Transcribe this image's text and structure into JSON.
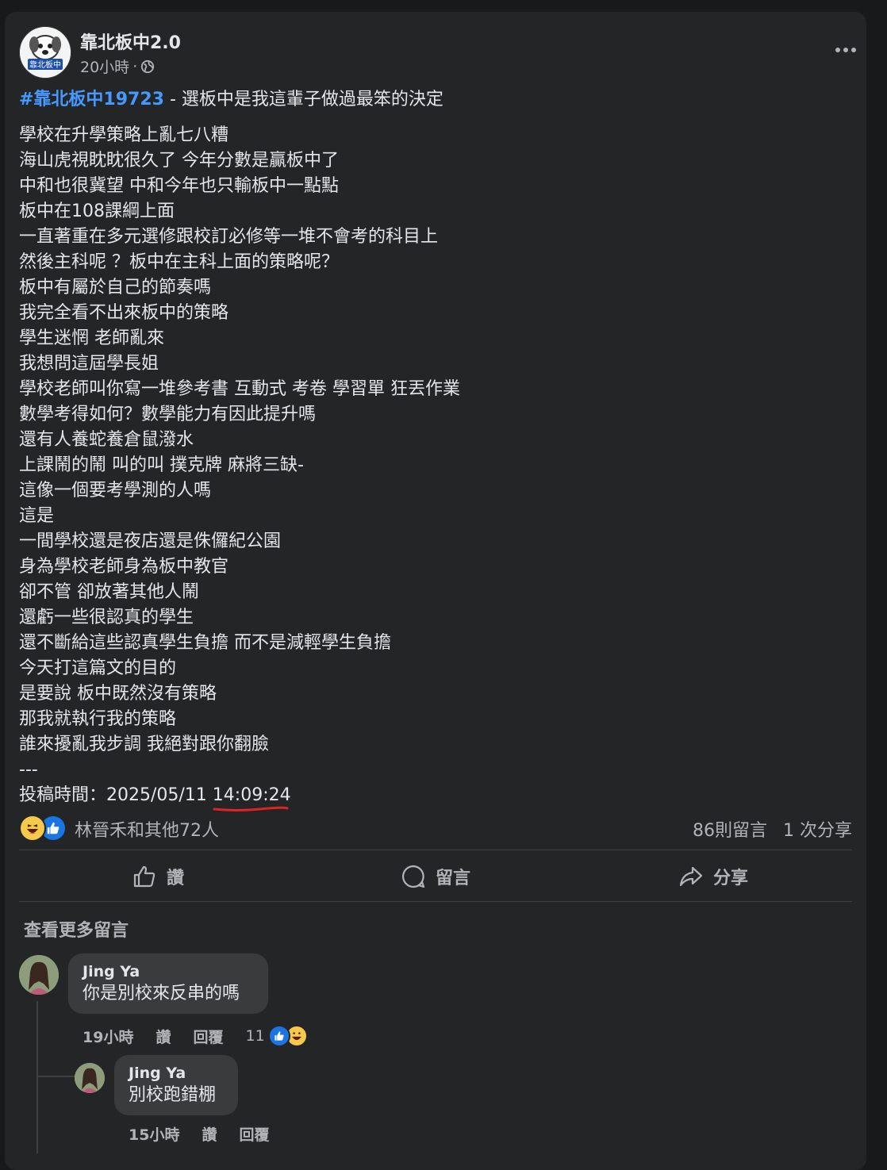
{
  "post": {
    "page_name": "靠北板中2.0",
    "time": "20小時",
    "separator": "·",
    "hashtag": "#靠北板中19723",
    "title_rest": " - 選板中是我這輩子做過最笨的決定",
    "body_lines": [
      "學校在升學策略上亂七八糟",
      "海山虎視眈眈很久了 今年分數是贏板中了",
      "中和也很冀望 中和今年也只輸板中一點點",
      "板中在108課綱上面",
      "一直著重在多元選修跟校訂必修等一堆不會考的科目上",
      "然後主科呢 ？板中在主科上面的策略呢？",
      "板中有屬於自己的節奏嗎",
      "我完全看不出來板中的策略",
      "學生迷惘 老師亂來",
      "我想問這屆學長姐",
      "學校老師叫你寫一堆參考書 互動式 考卷 學習單 狂丟作業",
      "數學考得如何？數學能力有因此提升嗎",
      "還有人養蛇養倉鼠潑水",
      "上課鬧的鬧 叫的叫 撲克牌 麻將三缺-",
      "這像一個要考學測的人嗎",
      "這是",
      "一間學校還是夜店還是侏儸紀公園",
      "身為學校老師身為板中教官",
      "卻不管 卻放著其他人鬧",
      "還虧一些很認真的學生",
      "還不斷給這些認真學生負擔 而不是減輕學生負擔",
      "今天打這篇文的目的",
      "是要說 板中既然沒有策略",
      "那我就執行我的策略",
      "誰來擾亂我步調 我絕對跟你翻臉",
      "---"
    ],
    "posted_label": "投稿時間：2025/05/11 ",
    "posted_time": "14:09:24",
    "reactions_names": "林晉禾和其他72人",
    "comments_count": "86則留言",
    "shares_count": "1 次分享",
    "underline_color": "#e02424"
  },
  "actions": {
    "like": "讚",
    "comment": "留言",
    "share": "分享"
  },
  "comments": {
    "see_more": "查看更多留言",
    "c1": {
      "author": "Jing Ya",
      "text": "你是別校來反串的嗎",
      "time": "19小時",
      "like": "讚",
      "reply": "回覆",
      "reaction_count": "11"
    },
    "c2": {
      "author": "Jing Ya",
      "text": "別校跑錯棚",
      "time": "15小時",
      "like": "讚",
      "reply": "回覆"
    }
  },
  "icons": {
    "more": "more-icon",
    "globe": "globe-icon",
    "like": "like-icon",
    "comment": "comment-icon",
    "share": "share-icon",
    "haha": "haha-reaction-icon",
    "thumbs": "like-reaction-icon"
  },
  "colors": {
    "hashtag": "#4599ff",
    "like_blue": "#1b74e4",
    "haha_yellow": "#f7c94b"
  }
}
